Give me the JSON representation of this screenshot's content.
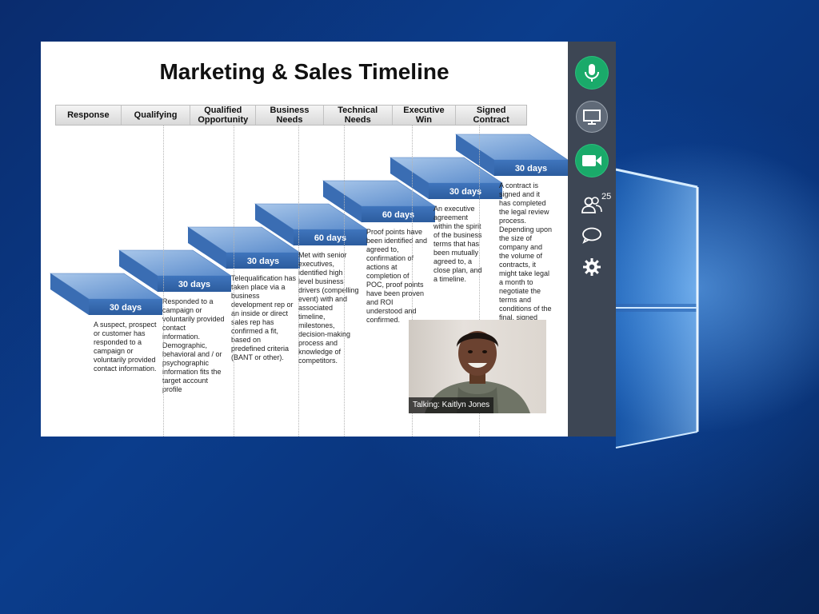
{
  "slide": {
    "title": "Marketing & Sales Timeline",
    "stages": [
      {
        "label": "Response",
        "width": 82
      },
      {
        "label": "Qualifying",
        "width": 87
      },
      {
        "label": "Qualified\nOpportunity",
        "width": 82
      },
      {
        "label": "Business\nNeeds",
        "width": 85
      },
      {
        "label": "Technical\nNeeds",
        "width": 86
      },
      {
        "label": "Executive\nWin",
        "width": 80
      },
      {
        "label": "Signed\nContract",
        "width": 88
      }
    ],
    "steps": [
      {
        "duration": "30 days",
        "description": "A suspect, prospect or customer has responded to a campaign or voluntarily provided contact information."
      },
      {
        "duration": "30 days",
        "description": "Responded to a campaign or voluntarily provided contact information. Demographic, behavioral and / or psychographic information fits the target account profile"
      },
      {
        "duration": "30 days",
        "description": "Telequalification has taken place via a business development rep or an inside or direct sales rep has confirmed a fit, based on predefined criteria (BANT or other)."
      },
      {
        "duration": "60 days",
        "description": "Met with senior executives, identified high level business drivers (compelling event) with and associated timeline, milestones, decision-making process and knowledge of competitors."
      },
      {
        "duration": "60 days",
        "description": "Proof points have been identified and agreed to, confirmation of actions at completion of POC, proof points have been proven and ROI understood and confirmed."
      },
      {
        "duration": "30 days",
        "description": "An executive agreement within the spirit of the business terms that has been mutually agreed to, a close plan, and a timeline."
      },
      {
        "duration": "30 days",
        "description": "A contract is signed and it has completed the legal review process. Depending upon the size of company and the volume of contracts, it might take legal a month to negotiate the terms and conditions of the final, signed contract."
      }
    ]
  },
  "sidebar": {
    "icons": [
      "microphone-icon",
      "screen-share-icon",
      "video-camera-icon",
      "participants-icon",
      "chat-icon",
      "gear-icon"
    ],
    "participants_count": "25",
    "colors": {
      "active": "#1aaa6a",
      "panel": "#3d4654"
    }
  },
  "video": {
    "talking_label": "Talking: Kaitlyn Jones"
  }
}
